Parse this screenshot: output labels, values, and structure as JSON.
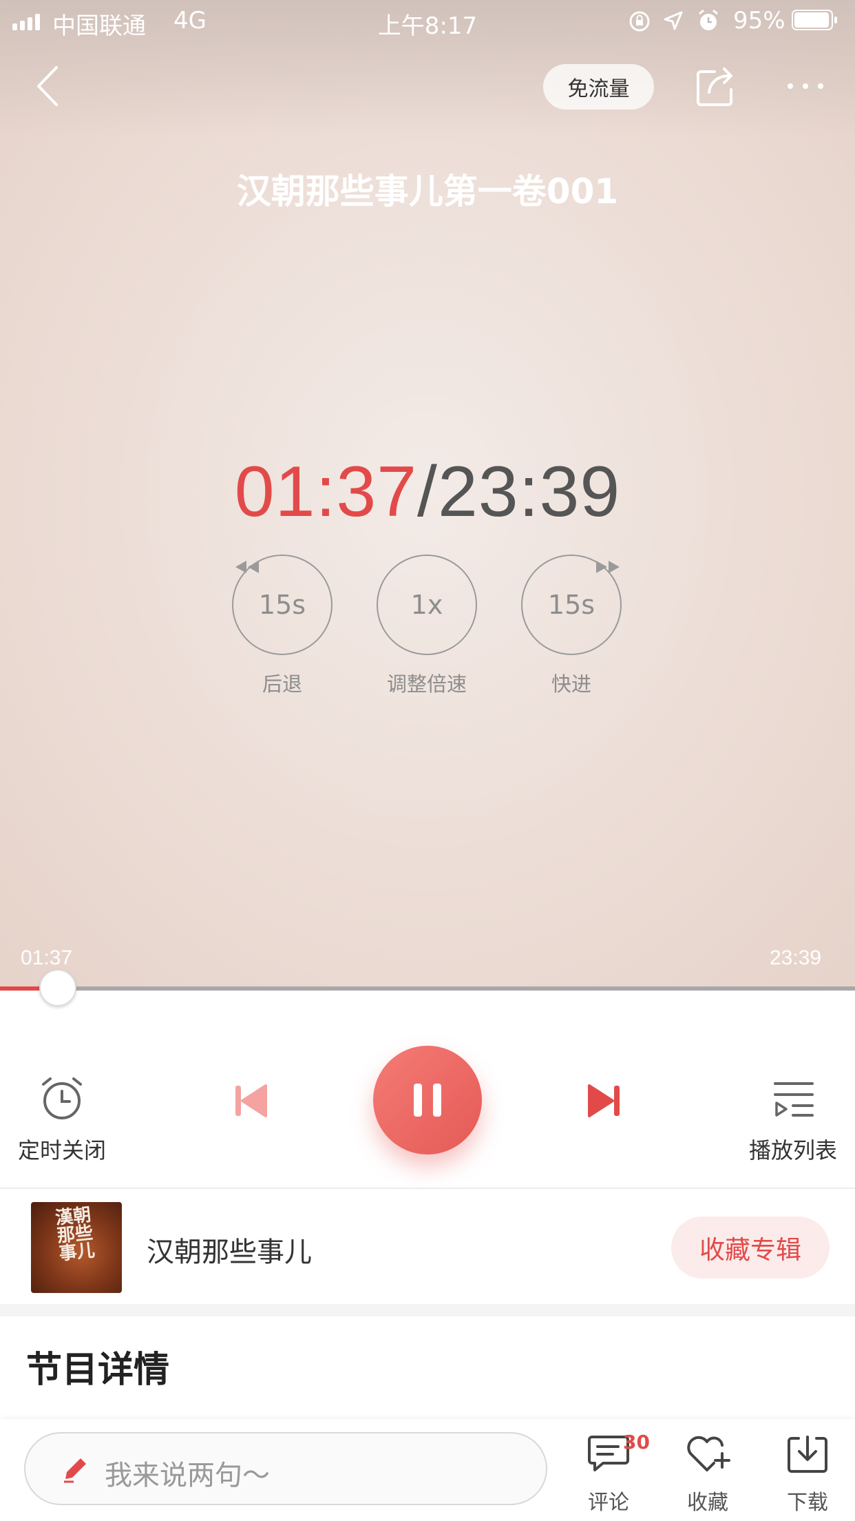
{
  "status_bar": {
    "carrier": "中国联通",
    "network": "4G",
    "time": "上午8:17",
    "battery": "95%"
  },
  "nav": {
    "free_data_label": "免流量"
  },
  "episode_title": "汉朝那些事儿第一卷001",
  "timer": {
    "current": "01:37",
    "separator": "/",
    "total": "23:39"
  },
  "quick_controls": {
    "rewind_value": "15s",
    "rewind_label": "后退",
    "speed_value": "1x",
    "speed_label": "调整倍速",
    "forward_value": "15s",
    "forward_label": "快进"
  },
  "progress": {
    "elapsed": "01:37",
    "duration": "23:39",
    "fraction": 0.068
  },
  "controls": {
    "sleep_timer_label": "定时关闭",
    "playlist_label": "播放列表"
  },
  "album": {
    "name": "汉朝那些事儿",
    "cover_text": "漢朝那些事儿",
    "favorite_button": "收藏专辑"
  },
  "section": {
    "title": "节目详情"
  },
  "bottom_bar": {
    "comment_placeholder": "我来说两句～",
    "comment_count": "30",
    "comment_label": "评论",
    "favorite_label": "收藏",
    "download_label": "下载"
  },
  "colors": {
    "accent": "#e24a4a",
    "play_button": "#ee6a65"
  }
}
